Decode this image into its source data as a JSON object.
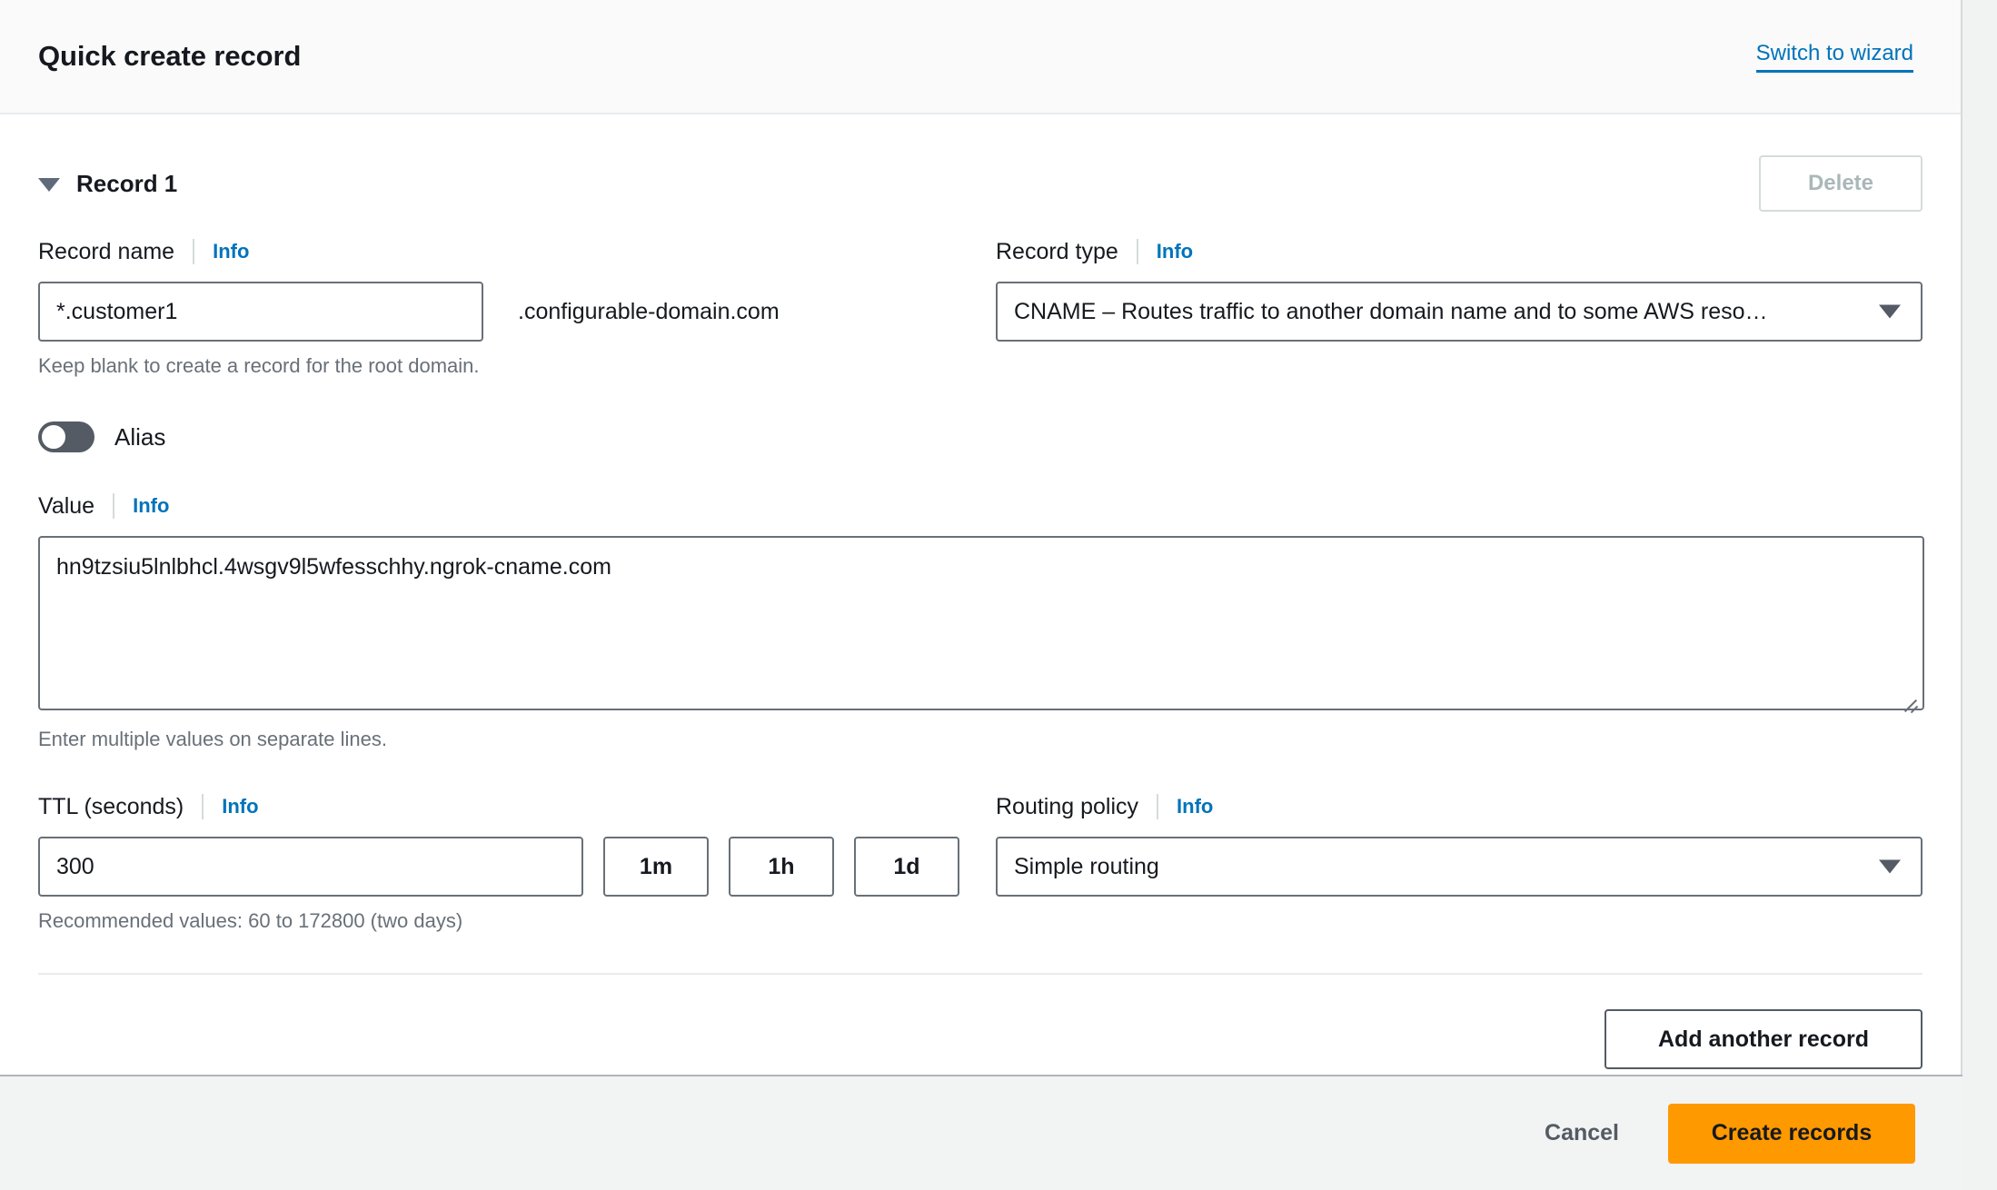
{
  "header": {
    "title": "Quick create record",
    "switch_link": "Switch to wizard"
  },
  "record": {
    "label": "Record 1",
    "delete_button": "Delete",
    "record_name": {
      "label": "Record name",
      "info": "Info",
      "value": "*.customer1",
      "placeholder": "",
      "domain_suffix": ".configurable-domain.com",
      "hint": "Keep blank to create a record for the root domain."
    },
    "record_type": {
      "label": "Record type",
      "info": "Info",
      "selected": "CNAME – Routes traffic to another domain name and to some AWS reso…"
    },
    "alias": {
      "label": "Alias",
      "state": "off"
    },
    "value": {
      "label": "Value",
      "info": "Info",
      "text": "hn9tzsiu5lnlbhcl.4wsgv9l5wfesschhy.ngrok-cname.com",
      "hint": "Enter multiple values on separate lines."
    },
    "ttl": {
      "label": "TTL (seconds)",
      "info": "Info",
      "value": "300",
      "quick_1m": "1m",
      "quick_1h": "1h",
      "quick_1d": "1d",
      "hint": "Recommended values: 60 to 172800 (two days)"
    },
    "routing_policy": {
      "label": "Routing policy",
      "info": "Info",
      "selected": "Simple routing"
    }
  },
  "actions": {
    "add_another": "Add another record",
    "cancel": "Cancel",
    "create": "Create records"
  },
  "colors": {
    "accent_link": "#0073bb",
    "primary_button": "#ff9900",
    "border": "#687078",
    "footer_bg": "#f2f3f3"
  }
}
